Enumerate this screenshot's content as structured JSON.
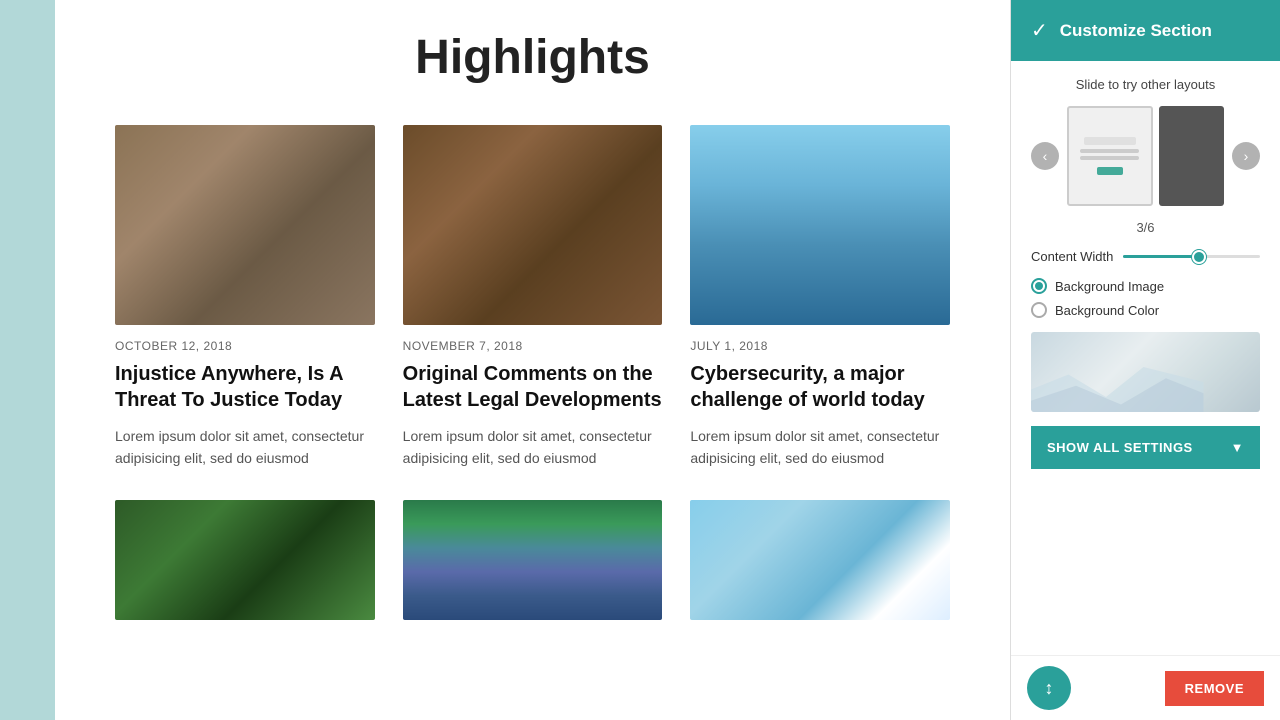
{
  "left_bar": {},
  "main": {
    "title": "Highlights",
    "cards_top": [
      {
        "date": "OCTOBER 12, 2018",
        "title": "Injustice Anywhere, Is A Threat To Justice Today",
        "body": "Lorem ipsum dolor sit amet, consectetur adipisicing elit, sed do eiusmod",
        "img_type": "business"
      },
      {
        "date": "NOVEMBER 7, 2018",
        "title": "Original Comments on the Latest Legal Developments",
        "body": "Lorem ipsum dolor sit amet, consectetur adipisicing elit, sed do eiusmod",
        "img_type": "gavel"
      },
      {
        "date": "JULY 1, 2018",
        "title": "Cybersecurity, a major challenge of world today",
        "body": "Lorem ipsum dolor sit amet, consectetur adipisicing elit, sed do eiusmod",
        "img_type": "buildings"
      }
    ],
    "cards_bottom": [
      {
        "img_type": "people"
      },
      {
        "img_type": "colorful"
      },
      {
        "img_type": "satellite"
      }
    ]
  },
  "right_panel": {
    "header_title": "Customize Section",
    "slide_label": "Slide to try other layouts",
    "layout_counter": "3/6",
    "content_width_label": "Content Width",
    "background_image_label": "Background Image",
    "background_color_label": "Background Color",
    "show_all_label": "SHOW ALL SETTINGS",
    "remove_label": "REMOVE",
    "background_image_selected": true,
    "background_color_selected": false
  }
}
